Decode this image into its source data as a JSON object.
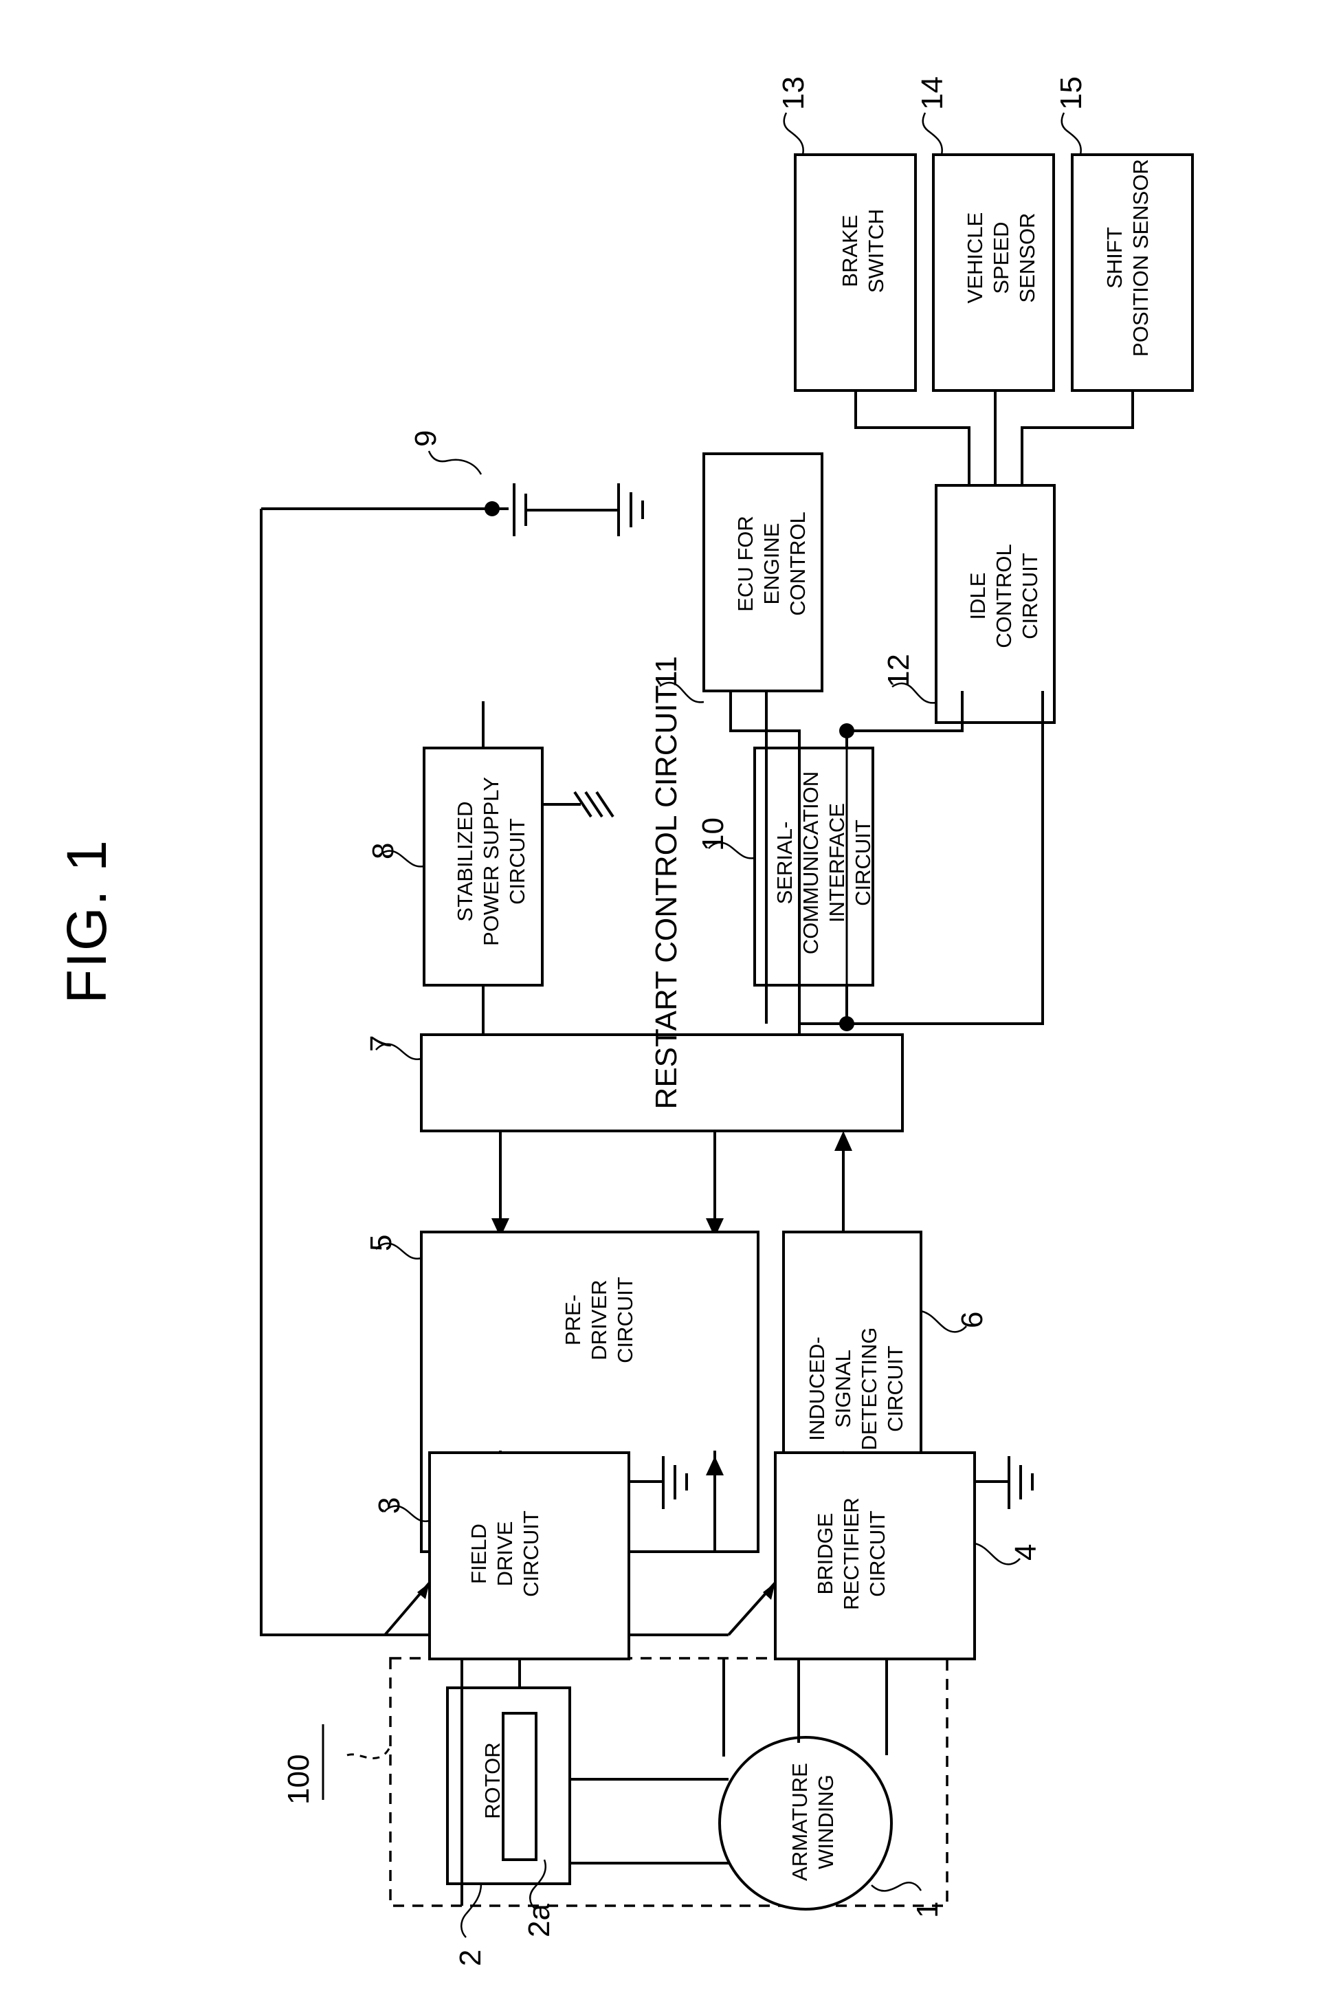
{
  "figure": {
    "title": "FIG. 1",
    "assembly_ref": "100"
  },
  "blocks": [
    {
      "id": "brake_switch",
      "label": "BRAKE\nSWITCH",
      "ref": "13"
    },
    {
      "id": "vehicle_speed",
      "label": "VEHICLE\nSPEED\nSENSOR",
      "ref": "14"
    },
    {
      "id": "shift_position",
      "label": "SHIFT\nPOSITION SENSOR",
      "ref": "15"
    },
    {
      "id": "ecu_engine",
      "label": "ECU FOR\nENGINE\nCONTROL",
      "ref": "11"
    },
    {
      "id": "idle_control",
      "label": "IDLE\nCONTROL\nCIRCUIT",
      "ref": "12"
    },
    {
      "id": "stabilized_psu",
      "label": "STABILIZED\nPOWER SUPPLY\nCIRCUIT",
      "ref": "8"
    },
    {
      "id": "serial_comm",
      "label": "SERIAL-\nCOMMUNICATION\nINTERFACE\nCIRCUIT",
      "ref": "10"
    },
    {
      "id": "restart_control",
      "label": "RESTART CONTROL CIRCUIT",
      "ref": "7"
    },
    {
      "id": "pre_driver",
      "label": "PRE-\nDRIVER\nCIRCUIT",
      "ref": "5"
    },
    {
      "id": "induced_signal",
      "label": "INDUCED-\nSIGNAL\nDETECTING\nCIRCUIT",
      "ref": "6"
    },
    {
      "id": "field_drive",
      "label": "FIELD\nDRIVE\nCIRCUIT",
      "ref": "3"
    },
    {
      "id": "bridge_rectifier",
      "label": "BRIDGE\nRECTIFIER\nCIRCUIT",
      "ref": "4"
    },
    {
      "id": "rotor",
      "label": "ROTOR",
      "ref": "2"
    },
    {
      "id": "field_winding",
      "label": "",
      "ref": "2a"
    },
    {
      "id": "armature_winding",
      "label": "ARMATURE\nWINDING",
      "ref": "1"
    },
    {
      "id": "battery",
      "label": "",
      "ref": "9"
    }
  ],
  "labels": {
    "brake_switch_l1": "BRAKE",
    "brake_switch_l2": "SWITCH",
    "vehicle_speed_l1": "VEHICLE",
    "vehicle_speed_l2": "SPEED",
    "vehicle_speed_l3": "SENSOR",
    "shift_position_l1": "SHIFT",
    "shift_position_l2": "POSITION SENSOR",
    "ecu_engine_l1": "ECU FOR",
    "ecu_engine_l2": "ENGINE",
    "ecu_engine_l3": "CONTROL",
    "idle_control_l1": "IDLE",
    "idle_control_l2": "CONTROL",
    "idle_control_l3": "CIRCUIT",
    "stabilized_psu_l1": "STABILIZED",
    "stabilized_psu_l2": "POWER SUPPLY",
    "stabilized_psu_l3": "CIRCUIT",
    "serial_comm_l1": "SERIAL-",
    "serial_comm_l2": "COMMUNICATION",
    "serial_comm_l3": "INTERFACE",
    "serial_comm_l4": "CIRCUIT",
    "restart_control_l1": "RESTART CONTROL CIRCUIT",
    "pre_driver_l1": "PRE-",
    "pre_driver_l2": "DRIVER",
    "pre_driver_l3": "CIRCUIT",
    "induced_l1": "INDUCED-",
    "induced_l2": "SIGNAL",
    "induced_l3": "DETECTING",
    "induced_l4": "CIRCUIT",
    "field_drive_l1": "FIELD",
    "field_drive_l2": "DRIVE",
    "field_drive_l3": "CIRCUIT",
    "bridge_l1": "BRIDGE",
    "bridge_l2": "RECTIFIER",
    "bridge_l3": "CIRCUIT",
    "rotor_l1": "ROTOR",
    "armature_l1": "ARMATURE",
    "armature_l2": "WINDING"
  },
  "refs": {
    "r1": "1",
    "r2": "2",
    "r2a": "2a",
    "r3": "3",
    "r4": "4",
    "r5": "5",
    "r6": "6",
    "r7": "7",
    "r8": "8",
    "r9": "9",
    "r10": "10",
    "r11": "11",
    "r12": "12",
    "r13": "13",
    "r14": "14",
    "r15": "15",
    "r100": "100"
  },
  "colors": {
    "ink": "#000000",
    "paper": "#ffffff"
  }
}
